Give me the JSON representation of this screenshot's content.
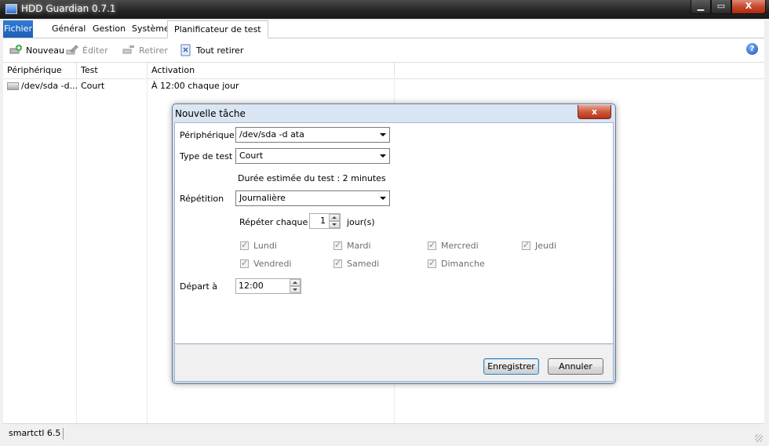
{
  "window": {
    "title": "HDD Guardian 0.7.1",
    "min": "▁",
    "max": "▭",
    "close": "X"
  },
  "ribbon": {
    "tabs": [
      "Fichier",
      "Général",
      "Gestion",
      "Système",
      "Planificateur de test"
    ],
    "active_index": 4
  },
  "toolbar": {
    "new": "Nouveau",
    "edit": "Éditer",
    "remove": "Retirer",
    "remove_all": "Tout retirer",
    "help": "?"
  },
  "list": {
    "columns": [
      "Périphérique",
      "Test",
      "Activation"
    ],
    "rows": [
      {
        "device": "/dev/sda -d...",
        "test": "Court",
        "activation": "À 12:00 chaque jour"
      }
    ]
  },
  "status": {
    "text": "smartctl 6.5"
  },
  "dialog": {
    "title": "Nouvelle tâche",
    "close": "x",
    "device_label": "Périphérique",
    "device_value": "/dev/sda -d ata",
    "test_type_label": "Type de test",
    "test_type_value": "Court",
    "duration_text": "Durée estimée du test : 2 minutes",
    "repetition_label": "Répétition",
    "repetition_value": "Journalière",
    "repeat_every_label": "Répéter chaque",
    "repeat_every_value": "1",
    "repeat_unit": "jour(s)",
    "days": [
      "Lundi",
      "Mardi",
      "Mercredi",
      "Jeudi",
      "Vendredi",
      "Samedi",
      "Dimanche"
    ],
    "start_label": "Départ à",
    "start_value": "12:00",
    "save_label": "Enregistrer",
    "cancel_label": "Annuler"
  }
}
